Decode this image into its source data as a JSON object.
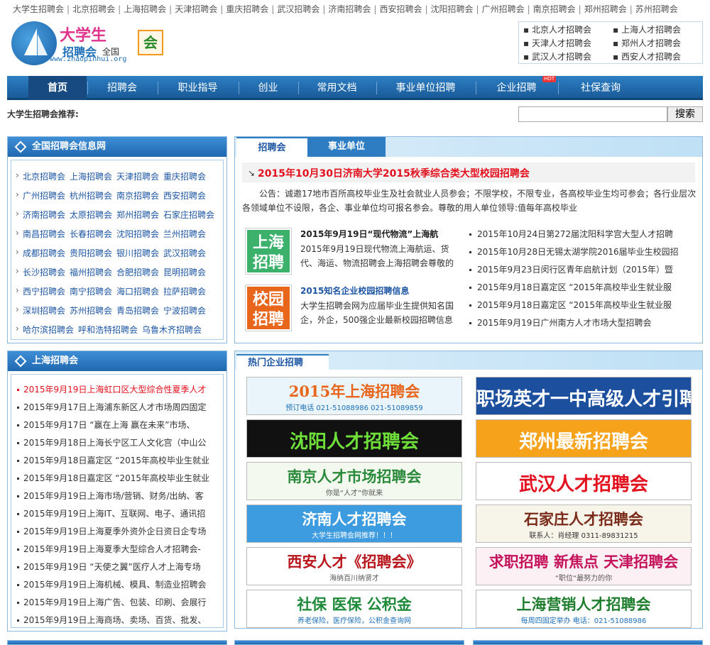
{
  "top_links": [
    "大学生招聘会",
    "北京招聘会",
    "上海招聘会",
    "天津招聘会",
    "重庆招聘会",
    "武汉招聘会",
    "济南招聘会",
    "西安招聘会",
    "沈阳招聘会",
    "广州招聘会",
    "南京招聘会",
    "郑州招聘会",
    "苏州招聘会"
  ],
  "logo": {
    "title": "大学生",
    "subtitle": "招聘会",
    "suffix": "全国",
    "url": "www.zhaopinhui.org",
    "badge": "会"
  },
  "city_box": [
    "北京人才招聘会",
    "上海人才招聘会",
    "天津人才招聘会",
    "郑州人才招聘会",
    "武汉人才招聘会",
    "西安人才招聘会"
  ],
  "nav": {
    "items": [
      "首页",
      "招聘会",
      "职业指导",
      "创业",
      "常用文档",
      "事业单位招聘",
      "企业招聘",
      "社保查询"
    ],
    "hot_label": "HOT"
  },
  "recommend_label": "大学生招聘会推荐:",
  "search": {
    "placeholder": "",
    "button": "搜索"
  },
  "national_panel": {
    "title": "全国招聘会信息网",
    "rows": [
      [
        "北京招聘会",
        "上海招聘会",
        "天津招聘会",
        "重庆招聘会"
      ],
      [
        "广州招聘会",
        "杭州招聘会",
        "南京招聘会",
        "西安招聘会"
      ],
      [
        "济南招聘会",
        "太原招聘会",
        "郑州招聘会",
        "石家庄招聘会"
      ],
      [
        "南昌招聘会",
        "长春招聘会",
        "沈阳招聘会",
        "兰州招聘会"
      ],
      [
        "成都招聘会",
        "贵阳招聘会",
        "银川招聘会",
        "武汉招聘会"
      ],
      [
        "长沙招聘会",
        "福州招聘会",
        "合肥招聘会",
        "昆明招聘会"
      ],
      [
        "西宁招聘会",
        "南宁招聘会",
        "海口招聘会",
        "拉萨招聘会"
      ],
      [
        "深圳招聘会",
        "苏州招聘会",
        "青岛招聘会",
        "宁波招聘会"
      ],
      [
        "哈尔滨招聘会",
        "呼和浩特招聘会",
        "乌鲁木齐招聘会"
      ]
    ]
  },
  "shanghai_panel": {
    "title": "上海招聘会",
    "items": [
      "2015年9月19日上海虹口区大型综合性夏季人才",
      "2015年9月17日上海浦东新区人才市场周四固定",
      "2015年9月17日 “赢在上海 赢在未来”市场、",
      "2015年9月18日上海长宁区工人文化宫（中山公",
      "2015年9月18日嘉定区 “2015年高校毕业生就业",
      "2015年9月18日嘉定区 “2015年高校毕业生就业",
      "2015年9月19日上海市场/营销、财务/出纳、客",
      "2015年9月19日上海IT、互联网、电子、通讯招",
      "2015年9月19日上海夏季外资外企日资日企专场",
      "2015年9月19日上海夏季大型综合人才招聘会-",
      "2015年9月19日 “天使之翼”医疗人才上海专场",
      "2015年9月19日上海机械、模具、制造业招聘会",
      "2015年9月19日上海广告、包装、印刷、会展行",
      "2015年9月19日上海商场、卖场、百货、批发、"
    ]
  },
  "main_panel": {
    "tabs": [
      "招聘会",
      "事业单位"
    ],
    "headline_arrow": "↘",
    "headline": "2015年10月30日济南大学2015秋季综合类大型校园招聘会",
    "notice": "公告：诚邀17地市百所高校毕业生及社会就业人员参会；不限学校，不限专业，各高校毕业生均可参会；各行业层次各领域单位不设限，各企、事业单位均可报名参会。尊敬的用人单位领导:值每年高校毕业",
    "news": [
      {
        "badge": [
          "上海",
          "招聘"
        ],
        "title": "2015年9月19日“现代物流”上海航",
        "desc": "2015年9月19日现代物流上海航运、货代、海运、物流招聘会上海招聘会尊敬的"
      },
      {
        "badge": [
          "校园",
          "招聘"
        ],
        "title": "2015知名企业校园招聘信息",
        "desc": "大学生招聘会网为应届毕业生提供知名国企，外企，500强企业最新校园招聘信息"
      }
    ],
    "right_list": [
      "2015年10月24日第272届沈阳科学宫大型人才招聘",
      "2015年10月28日无锡太湖学院2016届毕业生校园招",
      "2015年9月23日闵行区青年启航计划（2015年）暨",
      "2015年9月18日嘉定区 “2015年高校毕业生就业服",
      "2015年9月18日嘉定区 “2015年高校毕业生就业服",
      "2015年9月19日广州南方人才市场大型招聘会"
    ]
  },
  "hot_panel": {
    "title": "热门企业招聘",
    "ads": [
      {
        "title": "2015年上海招聘会",
        "sub": "预订电话 021-51088986 021-51089859",
        "bg": "#e9f4fb",
        "fg": "#e8661b",
        "sfg": "#1d6fb8"
      },
      {
        "title": "职场英才一中高级人才引聘",
        "sub": "",
        "bg": "#1d4f9f",
        "fg": "#ffffff",
        "sfg": "#ffffff"
      },
      {
        "title": "沈阳人才招聘会",
        "sub": "",
        "bg": "#111111",
        "fg": "#6fe03a",
        "sfg": "#ffffff"
      },
      {
        "title": "郑州最新招聘会",
        "sub": "",
        "bg": "#f7a21b",
        "fg": "#ffffff",
        "sfg": "#ffffff"
      },
      {
        "title": "南京人才市场招聘会",
        "sub": "你是“人才”你就来",
        "bg": "#f4f9f0",
        "fg": "#2a8a3a",
        "sfg": "#555555"
      },
      {
        "title": "武汉人才招聘会",
        "sub": "",
        "bg": "#ffffff",
        "fg": "#e3101d",
        "sfg": "#e3101d"
      },
      {
        "title": "济南人才招聘会",
        "sub": "大学生招聘会网推荐！！！",
        "bg": "#3d9be0",
        "fg": "#ffffff",
        "sfg": "#ffffff"
      },
      {
        "title": "石家庄人才招聘会",
        "sub": "联系人：肖经理 0311-89831215",
        "bg": "#f7f4ea",
        "fg": "#7a2a18",
        "sfg": "#333333"
      },
      {
        "title": "西安人才《招聘会》",
        "sub": "海纳百川纳贤才",
        "bg": "#ffffff",
        "fg": "#b8161c",
        "sfg": "#555555"
      },
      {
        "title": "求职招聘 新焦点 天津招聘会",
        "sub": "“职位“最努力的你",
        "bg": "#fdf0f5",
        "fg": "#c4135b",
        "sfg": "#555555"
      },
      {
        "title": "社保 医保 公积金",
        "sub": "养老保险，医疗保险，公积金查询网",
        "bg": "#ffffff",
        "fg": "#1f8a3a",
        "sfg": "#1d6fb8"
      },
      {
        "title": "上海营销人才招聘会",
        "sub": "每周四固定举办 电话：021-51088986",
        "bg": "#ffffff",
        "fg": "#1f7d2e",
        "sfg": "#1d6fb8"
      }
    ]
  }
}
